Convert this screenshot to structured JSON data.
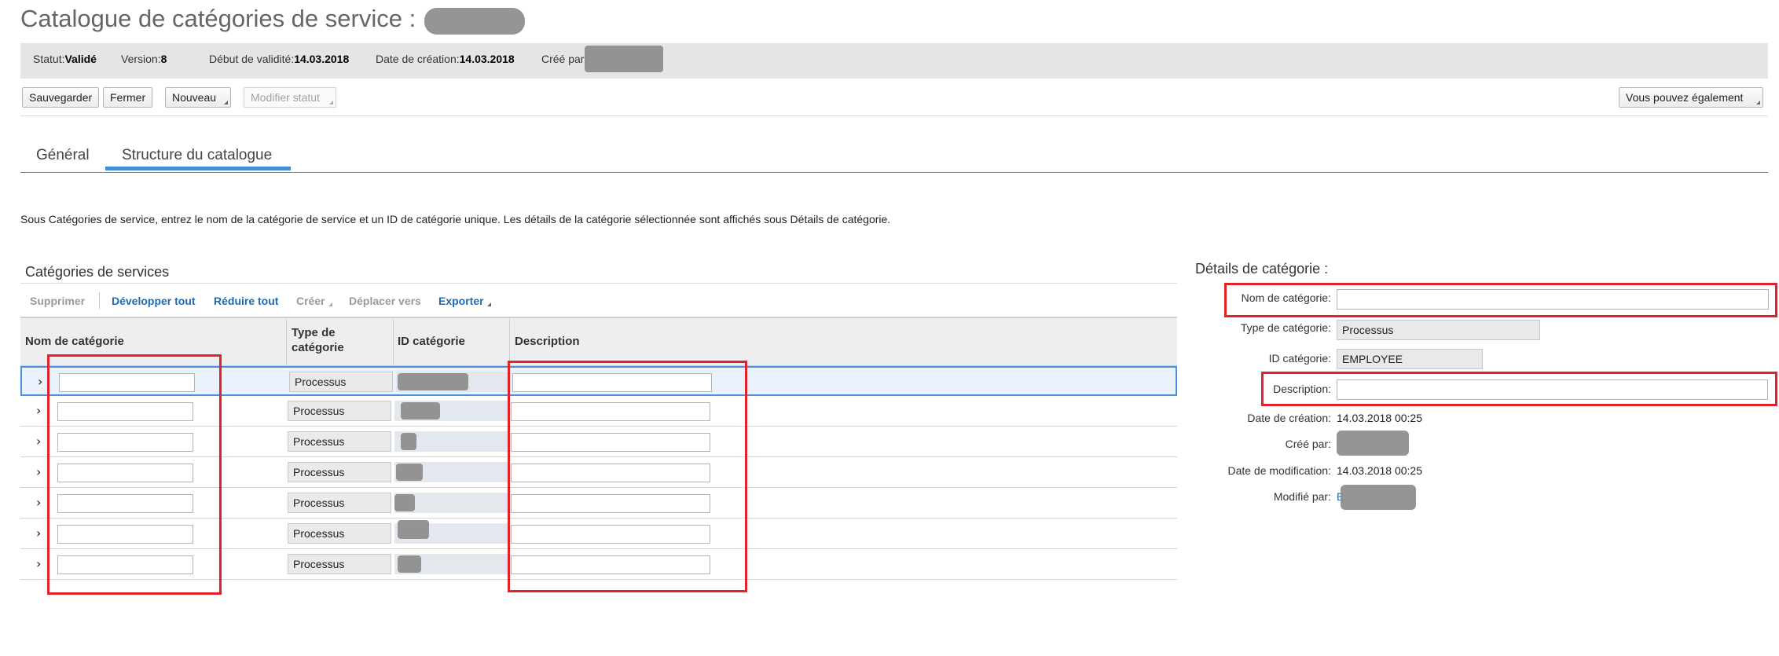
{
  "page": {
    "title": "Catalogue de catégories de service :"
  },
  "status": {
    "statut_label": "Statut:",
    "statut_value": "Validé",
    "version_label": "Version:",
    "version_value": "8",
    "debut_label": "Début de validité:",
    "debut_value": "14.03.2018",
    "creation_label": "Date de création:",
    "creation_value": "14.03.2018",
    "cree_par_label": "Créé par:"
  },
  "toolbar": {
    "save_label": "Sauvegarder",
    "close_label": "Fermer",
    "new_label": "Nouveau",
    "modify_status_label": "Modifier statut",
    "also_label": "Vous pouvez également"
  },
  "tabs": [
    {
      "label": "Général",
      "active": false
    },
    {
      "label": "Structure du catalogue",
      "active": true
    }
  ],
  "instructions": "Sous Catégories de service, entrez le nom de la catégorie de service et un ID de catégorie unique. Les détails de la catégorie sélectionnée sont affichés sous Détails de catégorie.",
  "services": {
    "title": "Catégories de services",
    "toolbar": {
      "delete": "Supprimer",
      "expand_all": "Développer tout",
      "collapse_all": "Réduire tout",
      "create": "Créer",
      "move_to": "Déplacer vers",
      "export": "Exporter"
    },
    "columns": {
      "name": "Nom de catégorie",
      "type_line1": "Type de",
      "type_line2": "catégorie",
      "id": "ID catégorie",
      "description": "Description"
    },
    "rows": [
      {
        "name": "",
        "type": "Processus",
        "id": "",
        "description": ""
      },
      {
        "name": "",
        "type": "Processus",
        "id": "",
        "description": ""
      },
      {
        "name": "",
        "type": "Processus",
        "id": "",
        "description": ""
      },
      {
        "name": "",
        "type": "Processus",
        "id": "",
        "description": ""
      },
      {
        "name": "",
        "type": "Processus",
        "id": "",
        "description": ""
      },
      {
        "name": "",
        "type": "Processus",
        "id": "",
        "description": ""
      },
      {
        "name": "",
        "type": "Processus",
        "id": "",
        "description": ""
      }
    ]
  },
  "details": {
    "title": "Détails de catégorie :",
    "name_label": "Nom de catégorie:",
    "name_value": "",
    "type_label": "Type de catégorie:",
    "type_value": "Processus",
    "id_label": "ID catégorie:",
    "id_value": "EMPLOYEE",
    "description_label": "Description:",
    "description_value": "",
    "created_date_label": "Date de création:",
    "created_date_value": "14.03.2018 00:25",
    "created_by_label": "Créé par:",
    "modified_date_label": "Date de modification:",
    "modified_date_value": "14.03.2018 00:25",
    "modified_by_label": "Modifié par:",
    "modified_by_value": "E"
  },
  "colors": {
    "accent": "#3f8fd9",
    "highlight": "#e3212b",
    "link": "#1a6bb5"
  },
  "icons": [
    "chevron-right-icon",
    "dropdown-corner-icon"
  ]
}
